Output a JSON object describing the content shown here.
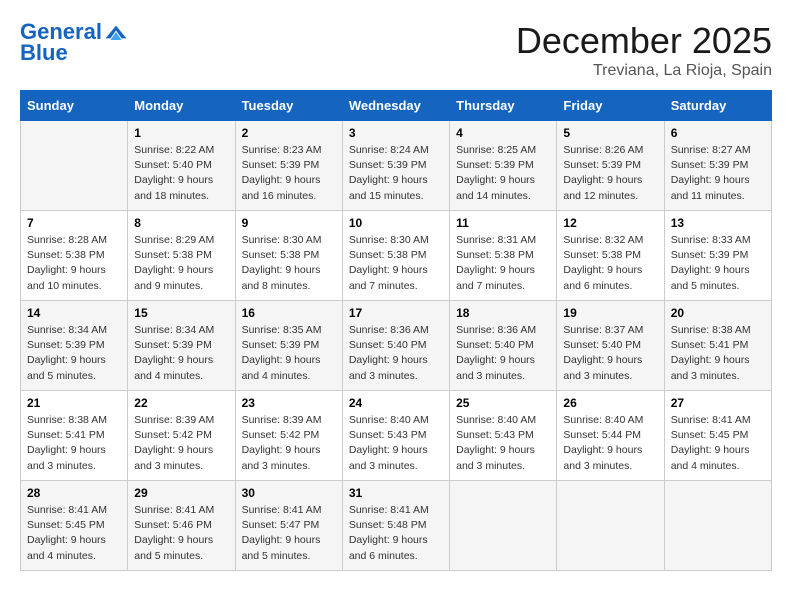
{
  "header": {
    "logo_line1": "General",
    "logo_line2": "Blue",
    "month_title": "December 2025",
    "location": "Treviana, La Rioja, Spain"
  },
  "days_of_week": [
    "Sunday",
    "Monday",
    "Tuesday",
    "Wednesday",
    "Thursday",
    "Friday",
    "Saturday"
  ],
  "weeks": [
    [
      {
        "day": "",
        "info": ""
      },
      {
        "day": "1",
        "info": "Sunrise: 8:22 AM\nSunset: 5:40 PM\nDaylight: 9 hours\nand 18 minutes."
      },
      {
        "day": "2",
        "info": "Sunrise: 8:23 AM\nSunset: 5:39 PM\nDaylight: 9 hours\nand 16 minutes."
      },
      {
        "day": "3",
        "info": "Sunrise: 8:24 AM\nSunset: 5:39 PM\nDaylight: 9 hours\nand 15 minutes."
      },
      {
        "day": "4",
        "info": "Sunrise: 8:25 AM\nSunset: 5:39 PM\nDaylight: 9 hours\nand 14 minutes."
      },
      {
        "day": "5",
        "info": "Sunrise: 8:26 AM\nSunset: 5:39 PM\nDaylight: 9 hours\nand 12 minutes."
      },
      {
        "day": "6",
        "info": "Sunrise: 8:27 AM\nSunset: 5:39 PM\nDaylight: 9 hours\nand 11 minutes."
      }
    ],
    [
      {
        "day": "7",
        "info": "Sunrise: 8:28 AM\nSunset: 5:38 PM\nDaylight: 9 hours\nand 10 minutes."
      },
      {
        "day": "8",
        "info": "Sunrise: 8:29 AM\nSunset: 5:38 PM\nDaylight: 9 hours\nand 9 minutes."
      },
      {
        "day": "9",
        "info": "Sunrise: 8:30 AM\nSunset: 5:38 PM\nDaylight: 9 hours\nand 8 minutes."
      },
      {
        "day": "10",
        "info": "Sunrise: 8:30 AM\nSunset: 5:38 PM\nDaylight: 9 hours\nand 7 minutes."
      },
      {
        "day": "11",
        "info": "Sunrise: 8:31 AM\nSunset: 5:38 PM\nDaylight: 9 hours\nand 7 minutes."
      },
      {
        "day": "12",
        "info": "Sunrise: 8:32 AM\nSunset: 5:38 PM\nDaylight: 9 hours\nand 6 minutes."
      },
      {
        "day": "13",
        "info": "Sunrise: 8:33 AM\nSunset: 5:39 PM\nDaylight: 9 hours\nand 5 minutes."
      }
    ],
    [
      {
        "day": "14",
        "info": "Sunrise: 8:34 AM\nSunset: 5:39 PM\nDaylight: 9 hours\nand 5 minutes."
      },
      {
        "day": "15",
        "info": "Sunrise: 8:34 AM\nSunset: 5:39 PM\nDaylight: 9 hours\nand 4 minutes."
      },
      {
        "day": "16",
        "info": "Sunrise: 8:35 AM\nSunset: 5:39 PM\nDaylight: 9 hours\nand 4 minutes."
      },
      {
        "day": "17",
        "info": "Sunrise: 8:36 AM\nSunset: 5:40 PM\nDaylight: 9 hours\nand 3 minutes."
      },
      {
        "day": "18",
        "info": "Sunrise: 8:36 AM\nSunset: 5:40 PM\nDaylight: 9 hours\nand 3 minutes."
      },
      {
        "day": "19",
        "info": "Sunrise: 8:37 AM\nSunset: 5:40 PM\nDaylight: 9 hours\nand 3 minutes."
      },
      {
        "day": "20",
        "info": "Sunrise: 8:38 AM\nSunset: 5:41 PM\nDaylight: 9 hours\nand 3 minutes."
      }
    ],
    [
      {
        "day": "21",
        "info": "Sunrise: 8:38 AM\nSunset: 5:41 PM\nDaylight: 9 hours\nand 3 minutes."
      },
      {
        "day": "22",
        "info": "Sunrise: 8:39 AM\nSunset: 5:42 PM\nDaylight: 9 hours\nand 3 minutes."
      },
      {
        "day": "23",
        "info": "Sunrise: 8:39 AM\nSunset: 5:42 PM\nDaylight: 9 hours\nand 3 minutes."
      },
      {
        "day": "24",
        "info": "Sunrise: 8:40 AM\nSunset: 5:43 PM\nDaylight: 9 hours\nand 3 minutes."
      },
      {
        "day": "25",
        "info": "Sunrise: 8:40 AM\nSunset: 5:43 PM\nDaylight: 9 hours\nand 3 minutes."
      },
      {
        "day": "26",
        "info": "Sunrise: 8:40 AM\nSunset: 5:44 PM\nDaylight: 9 hours\nand 3 minutes."
      },
      {
        "day": "27",
        "info": "Sunrise: 8:41 AM\nSunset: 5:45 PM\nDaylight: 9 hours\nand 4 minutes."
      }
    ],
    [
      {
        "day": "28",
        "info": "Sunrise: 8:41 AM\nSunset: 5:45 PM\nDaylight: 9 hours\nand 4 minutes."
      },
      {
        "day": "29",
        "info": "Sunrise: 8:41 AM\nSunset: 5:46 PM\nDaylight: 9 hours\nand 5 minutes."
      },
      {
        "day": "30",
        "info": "Sunrise: 8:41 AM\nSunset: 5:47 PM\nDaylight: 9 hours\nand 5 minutes."
      },
      {
        "day": "31",
        "info": "Sunrise: 8:41 AM\nSunset: 5:48 PM\nDaylight: 9 hours\nand 6 minutes."
      },
      {
        "day": "",
        "info": ""
      },
      {
        "day": "",
        "info": ""
      },
      {
        "day": "",
        "info": ""
      }
    ]
  ]
}
